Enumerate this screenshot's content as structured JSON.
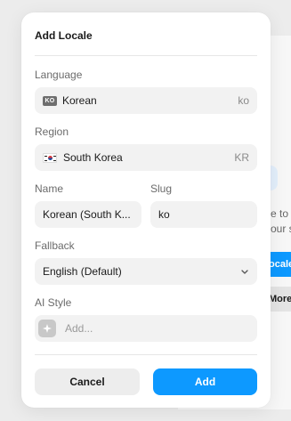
{
  "background": {
    "snippet_line1": "e to",
    "snippet_line2": "our s",
    "primary_button": "ocale",
    "secondary_button": "More"
  },
  "dialog": {
    "title": "Add Locale",
    "language": {
      "label": "Language",
      "badge": "KO",
      "value": "Korean",
      "code": "ko"
    },
    "region": {
      "label": "Region",
      "flag_icon": "south-korea-flag",
      "value": "South Korea",
      "code": "KR"
    },
    "name": {
      "label": "Name",
      "value": "Korean (South K..."
    },
    "slug": {
      "label": "Slug",
      "value": "ko"
    },
    "fallback": {
      "label": "Fallback",
      "value": "English (Default)"
    },
    "ai_style": {
      "label": "AI Style",
      "placeholder": "Add..."
    },
    "cancel_label": "Cancel",
    "add_label": "Add",
    "accent_color": "#0d99ff"
  }
}
